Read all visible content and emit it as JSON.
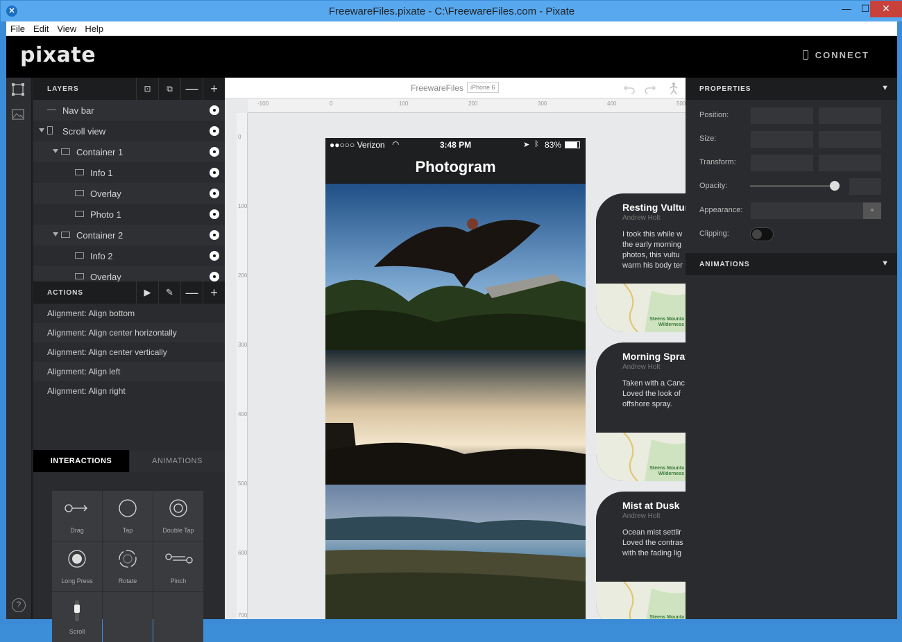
{
  "window": {
    "title": "FreewareFiles.pixate - C:\\FreewareFiles.com - Pixate",
    "minimize": "—",
    "maximize": "☐",
    "close": "✕",
    "icon": "✕"
  },
  "menu": [
    "File",
    "Edit",
    "View",
    "Help"
  ],
  "header": {
    "logo": "pixate",
    "connect": "CONNECT"
  },
  "layers": {
    "title": "LAYERS",
    "rows": [
      {
        "name": "Nav bar",
        "indent": 0,
        "caret": false,
        "icon": "line-icon"
      },
      {
        "name": "Scroll view",
        "indent": 0,
        "caret": true,
        "icon": "scroll-icon"
      },
      {
        "name": "Container 1",
        "indent": 1,
        "caret": true,
        "icon": "rect-icon"
      },
      {
        "name": "Info 1",
        "indent": 2,
        "caret": false,
        "icon": "rect-icon"
      },
      {
        "name": "Overlay",
        "indent": 2,
        "caret": false,
        "icon": "rect-icon"
      },
      {
        "name": "Photo 1",
        "indent": 2,
        "caret": false,
        "icon": "rect-icon"
      },
      {
        "name": "Container 2",
        "indent": 1,
        "caret": true,
        "icon": "rect-icon"
      },
      {
        "name": "Info 2",
        "indent": 2,
        "caret": false,
        "icon": "rect-icon"
      },
      {
        "name": "Overlay",
        "indent": 2,
        "caret": false,
        "icon": "rect-icon"
      }
    ]
  },
  "actions": {
    "title": "ACTIONS",
    "rows": [
      "Alignment: Align bottom",
      "Alignment: Align center horizontally",
      "Alignment: Align center vertically",
      "Alignment: Align left",
      "Alignment: Align right"
    ]
  },
  "tabs": {
    "interactions": "INTERACTIONS",
    "animations": "ANIMATIONS"
  },
  "gestures": [
    "Drag",
    "Tap",
    "Double Tap",
    "Long Press",
    "Rotate",
    "Pinch",
    "Scroll"
  ],
  "canvas": {
    "project": "FreewareFiles",
    "device": "iPhone 6",
    "ruler_h": [
      "-100",
      "0",
      "100",
      "200",
      "300",
      "400",
      "500"
    ],
    "ruler_v": [
      "0",
      "100",
      "200",
      "300",
      "400",
      "500",
      "600",
      "700"
    ]
  },
  "phone": {
    "carrier": "●●○○○ Verizon",
    "time": "3:48 PM",
    "battery": "83%",
    "nav_title": "Photogram"
  },
  "cards": [
    {
      "title": "Resting Vultur",
      "author": "Andrew Holt",
      "body": [
        "I took this while w",
        "the early morning",
        "photos, this vultu",
        "warm his body ter"
      ],
      "map_label": "Steens Mounta\nWilderness"
    },
    {
      "title": "Morning Spray",
      "author": "Andrew Holt",
      "body": [
        "Taken with a Canc",
        "Loved the look of",
        "offshore spray."
      ],
      "map_label": "Steens Mounta\nWilderness"
    },
    {
      "title": "Mist at Dusk",
      "author": "Andrew Holt",
      "body": [
        "Ocean mist settlir",
        "Loved the contras",
        "with the fading lig"
      ],
      "map_label": "Steens Mounta\nWilderness"
    }
  ],
  "properties": {
    "title": "PROPERTIES",
    "labels": {
      "position": "Position:",
      "size": "Size:",
      "transform": "Transform:",
      "opacity": "Opacity:",
      "appearance": "Appearance:",
      "clipping": "Clipping:"
    },
    "opacity": 1.0,
    "clipping": false,
    "animations_title": "ANIMATIONS"
  },
  "colors": {
    "titlebar": "#57a8ef",
    "close": "#c8413b",
    "panel": "#2a2b2e",
    "header": "#000000",
    "accent": "#ffffff"
  }
}
